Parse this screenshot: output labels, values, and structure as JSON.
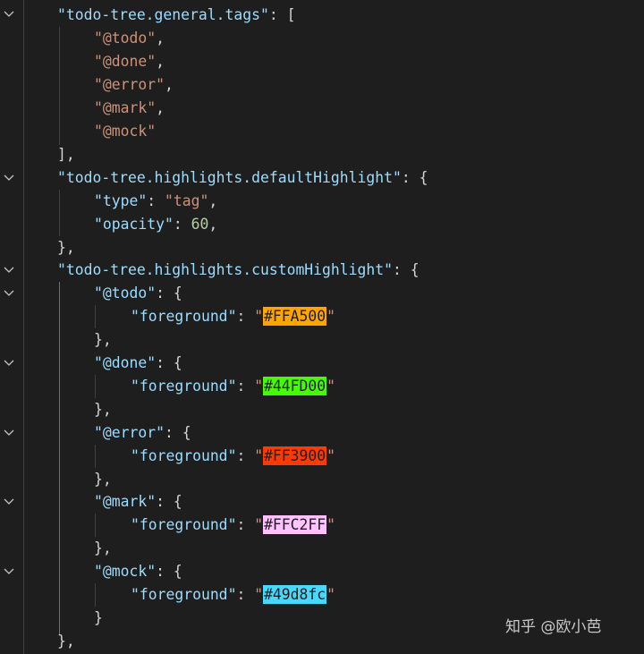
{
  "editor": {
    "tags_key": "todo-tree.general.tags",
    "tags": [
      "@todo",
      "@done",
      "@error",
      "@mark",
      "@mock"
    ],
    "default_highlight_key": "todo-tree.highlights.defaultHighlight",
    "type_key": "type",
    "type_value": "tag",
    "opacity_key": "opacity",
    "opacity_value": "60",
    "custom_highlight_key": "todo-tree.highlights.customHighlight",
    "foreground_key": "foreground",
    "custom": [
      {
        "tag": "@todo",
        "color": "#FFA500"
      },
      {
        "tag": "@done",
        "color": "#44FD00"
      },
      {
        "tag": "@error",
        "color": "#FF3900"
      },
      {
        "tag": "@mark",
        "color": "#FFC2FF"
      },
      {
        "tag": "@mock",
        "color": "#49d8fc"
      }
    ]
  },
  "watermark": "知乎 @欧小芭",
  "theme": {
    "background": "#1e1e1e",
    "key_color": "#9cdcfe",
    "string_color": "#ce9178",
    "number_color": "#b5cea8"
  }
}
